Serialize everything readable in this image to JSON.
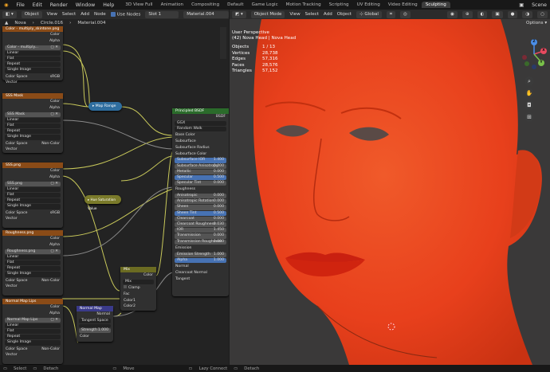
{
  "topbar": {
    "menus": [
      "File",
      "Edit",
      "Render",
      "Window",
      "Help"
    ],
    "tabs": [
      "3D View Full",
      "Animation",
      "Compositing",
      "Default",
      "Game Logic",
      "Motion Tracking",
      "Scripting",
      "UV Editing",
      "Video Editing",
      "Sculpting"
    ],
    "active_tab": "Sculpting",
    "scene_label": "Scene"
  },
  "node_editor_header": {
    "mode": "Object",
    "menus": [
      "View",
      "Select",
      "Add",
      "Node"
    ],
    "use_nodes_label": "Use Nodes",
    "slot": "Slot 1",
    "material": "Material.004"
  },
  "breadcrumb": [
    "Nova",
    "Circle.016",
    "Material.004"
  ],
  "viewport_header": {
    "mode": "Object Mode",
    "menus": [
      "View",
      "Select",
      "Add",
      "Object"
    ],
    "orientation": "Global",
    "options_label": "Options"
  },
  "viewport": {
    "perspective": "User Perspective",
    "object_name": "(42) Nova Head | Nova Head",
    "stats": [
      {
        "label": "Objects",
        "value": "1 / 13"
      },
      {
        "label": "Vertices",
        "value": "28,738"
      },
      {
        "label": "Edges",
        "value": "57,316"
      },
      {
        "label": "Faces",
        "value": "28,576"
      },
      {
        "label": "Triangles",
        "value": "57,152"
      }
    ]
  },
  "nodes": {
    "img1": {
      "title": "Color - multiply_skintone.png",
      "color_out": "Color",
      "alpha_out": "Alpha",
      "image": "Color - multiply...",
      "interp": "Linear",
      "proj": "Flat",
      "ext": "Repeat",
      "source": "Single Image",
      "cs_label": "Color Space",
      "cs": "sRGB",
      "vector": "Vector"
    },
    "sss": {
      "title": "SSS Mask",
      "color_out": "Color",
      "alpha_out": "Alpha",
      "image": "SSS Mask",
      "interp": "Linear",
      "proj": "Flat",
      "ext": "Repeat",
      "source": "Single Image",
      "cs_label": "Color Space",
      "cs": "Non-Color",
      "vector": "Vector"
    },
    "ssspng": {
      "title": "SSS.png",
      "color_out": "Color",
      "alpha_out": "Alpha",
      "image": "SSS.png",
      "interp": "Linear",
      "proj": "Flat",
      "ext": "Repeat",
      "source": "Single Image",
      "cs_label": "Color Space",
      "cs": "sRGB",
      "vector": "Vector"
    },
    "rough": {
      "title": "Roughness.png",
      "color_out": "Color",
      "alpha_out": "Alpha",
      "image": "Roughness.png",
      "interp": "Linear",
      "proj": "Flat",
      "ext": "Repeat",
      "source": "Single Image",
      "cs_label": "Color Space",
      "cs": "Non-Color",
      "vector": "Vector"
    },
    "nmap": {
      "title": "Normal Map Lips",
      "color_out": "Color",
      "alpha_out": "Alpha",
      "image": "Normal Map Lips",
      "interp": "Linear",
      "proj": "Flat",
      "ext": "Repeat",
      "source": "Single Image",
      "cs_label": "Color Space",
      "cs": "Non-Color",
      "vector": "Vector"
    },
    "maprange": {
      "title": "Map Range"
    },
    "hsv": {
      "title": "Hue Saturation Value"
    },
    "mix": {
      "title": "Mix",
      "color_out": "Color",
      "blend": "Mix",
      "clamp": "Clamp",
      "fac": "Fac",
      "color1": "Color1",
      "color2": "Color2"
    },
    "normalmap": {
      "title": "Normal Map",
      "normal_out": "Normal",
      "space": "Tangent Space",
      "strength_label": "Strength",
      "strength": "1.000",
      "color_in": "Color"
    },
    "bsdf": {
      "title": "Principled BSDF",
      "bsdf_out": "BSDF",
      "dist": "GGX",
      "sss_method": "Random Walk",
      "inputs_top": [
        "Base Color",
        "Subsurface",
        "Subsurface Radius",
        "Subsurface Color"
      ],
      "values": [
        {
          "label": "Subsurface IOR",
          "value": "1.400",
          "blue": true
        },
        {
          "label": "Subsurface Anisotropy",
          "value": "0.000",
          "blue": false
        },
        {
          "label": "Metallic",
          "value": "0.000",
          "blue": false
        },
        {
          "label": "Specular",
          "value": "0.500",
          "blue": true
        },
        {
          "label": "Specular Tint",
          "value": "0.000",
          "blue": false
        }
      ],
      "roughness": "Roughness",
      "values2": [
        {
          "label": "Anisotropic",
          "value": "0.000",
          "blue": false
        },
        {
          "label": "Anisotropic Rotation",
          "value": "0.000",
          "blue": false
        },
        {
          "label": "Sheen",
          "value": "0.000",
          "blue": false
        },
        {
          "label": "Sheen Tint",
          "value": "0.500",
          "blue": true
        },
        {
          "label": "Clearcoat",
          "value": "0.000",
          "blue": false
        },
        {
          "label": "Clearcoat Roughness",
          "value": "0.030",
          "blue": false
        },
        {
          "label": "IOR",
          "value": "1.450",
          "blue": false
        },
        {
          "label": "Transmission",
          "value": "0.000",
          "blue": false
        },
        {
          "label": "Transmission Roughness",
          "value": "0.000",
          "blue": false
        }
      ],
      "emission": "Emission",
      "emission_strength": {
        "label": "Emission Strength",
        "value": "1.000"
      },
      "alpha": {
        "label": "Alpha",
        "value": "1.000"
      },
      "outputs_bottom": [
        "Normal",
        "Clearcoat Normal",
        "Tangent"
      ]
    }
  },
  "statusbar": [
    "Select",
    "Detach",
    "Move",
    "Lazy Connect",
    "Detach"
  ],
  "colors": {
    "accent": "#4772b3",
    "image_header": "#8a4b17",
    "bsdf_header": "#2b6b2b",
    "skin": "#e8401c"
  }
}
